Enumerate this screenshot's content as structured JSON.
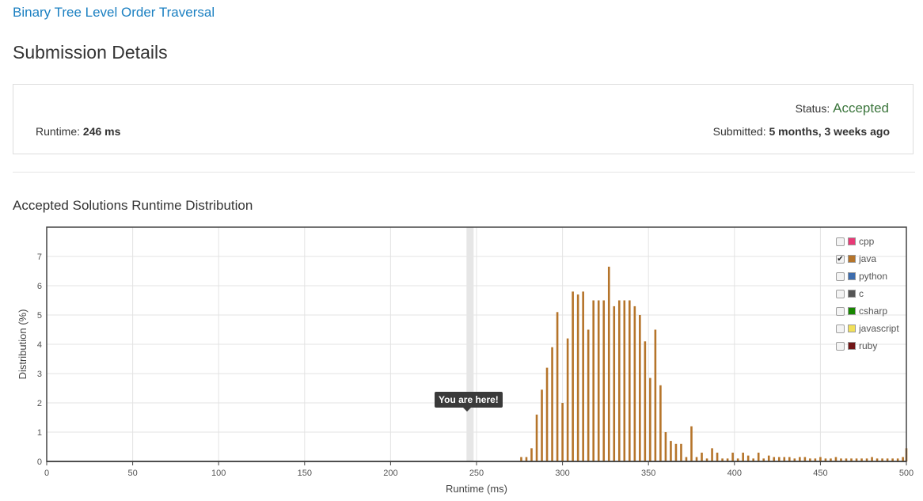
{
  "problem": {
    "title": "Binary Tree Level Order Traversal"
  },
  "page": {
    "title": "Submission Details"
  },
  "submission": {
    "status_label": "Status:",
    "status_value": "Accepted",
    "runtime_label": "Runtime:",
    "runtime_value": "246 ms",
    "submitted_label": "Submitted:",
    "submitted_value": "5 months, 3 weeks ago",
    "status_color": "#3c763d"
  },
  "section": {
    "title": "Accepted Solutions Runtime Distribution"
  },
  "chart_data": {
    "type": "bar",
    "title": "",
    "xlabel": "Runtime (ms)",
    "ylabel": "Distribution (%)",
    "xlim": [
      0,
      500
    ],
    "ylim": [
      0,
      8
    ],
    "xticks": [
      0,
      50,
      100,
      150,
      200,
      250,
      300,
      350,
      400,
      450,
      500
    ],
    "yticks": [
      0,
      1,
      2,
      3,
      4,
      5,
      6,
      7
    ],
    "grid": true,
    "legend_placement": "top-right",
    "marker": {
      "x": 246,
      "label": "You are here!"
    },
    "bar_color": "#b5742a",
    "series": [
      {
        "name": "java",
        "x": [
          276,
          279,
          282,
          285,
          288,
          291,
          294,
          297,
          300,
          303,
          306,
          309,
          312,
          315,
          318,
          321,
          324,
          327,
          330,
          333,
          336,
          339,
          342,
          345,
          348,
          351,
          354,
          357,
          360,
          363,
          366,
          369,
          372,
          375,
          378,
          381,
          384,
          387,
          390,
          393,
          396,
          399,
          402,
          405,
          408,
          411,
          414,
          417,
          420,
          423,
          426,
          429,
          432,
          435,
          438,
          441,
          444,
          447,
          450,
          453,
          456,
          459,
          462,
          465,
          468,
          471,
          474,
          477,
          480,
          483,
          486,
          489,
          492,
          495,
          498,
          500
        ],
        "y": [
          0.15,
          0.15,
          0.45,
          1.6,
          2.45,
          3.2,
          3.9,
          5.1,
          2.0,
          4.2,
          5.8,
          5.7,
          5.8,
          4.5,
          5.5,
          5.5,
          5.5,
          6.65,
          5.3,
          5.5,
          5.5,
          5.5,
          5.3,
          5.0,
          4.1,
          2.85,
          4.5,
          2.6,
          1.0,
          0.7,
          0.6,
          0.6,
          0.15,
          1.2,
          0.15,
          0.3,
          0.1,
          0.45,
          0.3,
          0.1,
          0.1,
          0.3,
          0.1,
          0.3,
          0.2,
          0.1,
          0.3,
          0.1,
          0.2,
          0.15,
          0.15,
          0.15,
          0.15,
          0.1,
          0.15,
          0.15,
          0.1,
          0.1,
          0.15,
          0.1,
          0.1,
          0.15,
          0.1,
          0.1,
          0.1,
          0.1,
          0.1,
          0.1,
          0.15,
          0.1,
          0.1,
          0.1,
          0.1,
          0.1,
          0.15,
          0.45
        ]
      }
    ],
    "legend": [
      {
        "name": "cpp",
        "color": "#e83a76",
        "checked": false
      },
      {
        "name": "java",
        "color": "#b5742a",
        "checked": true
      },
      {
        "name": "python",
        "color": "#3d6cad",
        "checked": false
      },
      {
        "name": "c",
        "color": "#555555",
        "checked": false
      },
      {
        "name": "csharp",
        "color": "#178600",
        "checked": false
      },
      {
        "name": "javascript",
        "color": "#f1e05a",
        "checked": false
      },
      {
        "name": "ruby",
        "color": "#701516",
        "checked": false
      }
    ]
  }
}
